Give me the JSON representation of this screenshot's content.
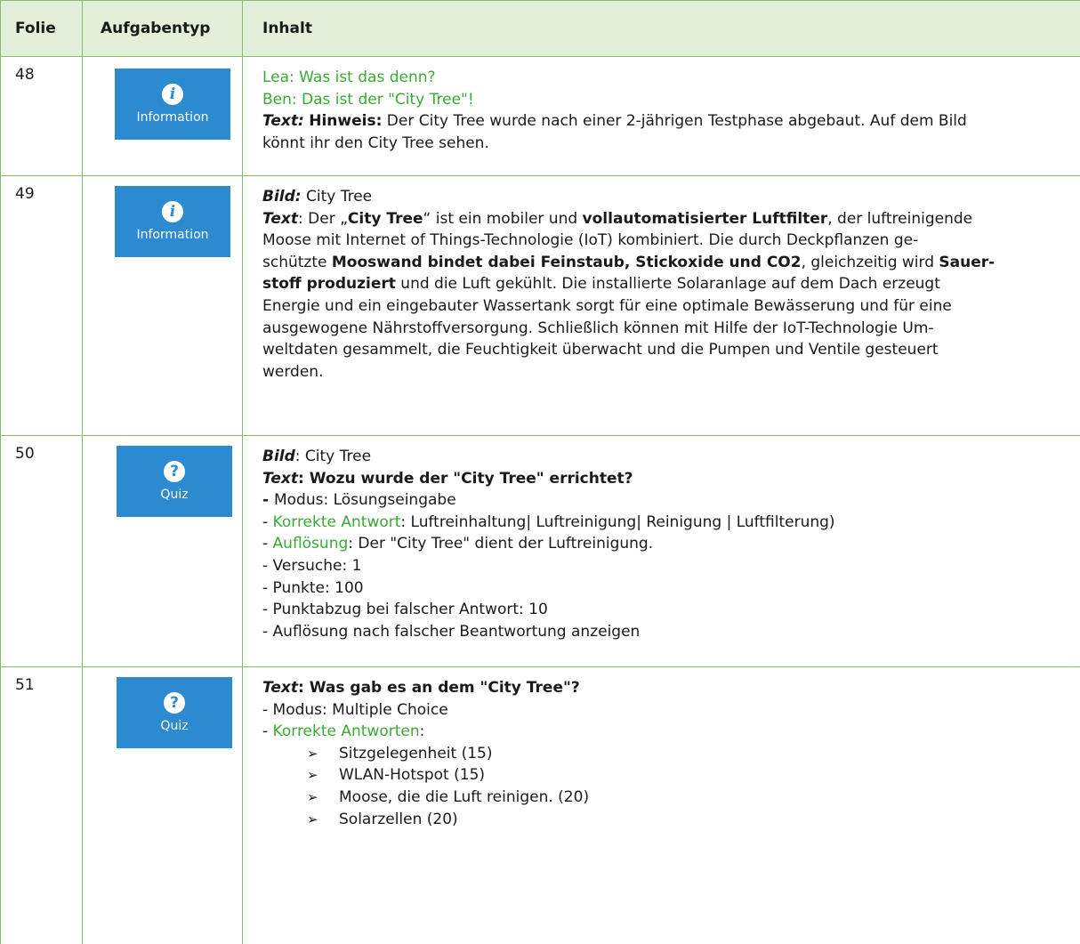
{
  "header": {
    "folie": "Folie",
    "aufgabentyp": "Aufgabentyp",
    "inhalt": "Inhalt"
  },
  "rows": [
    {
      "folie": "48",
      "tile": {
        "type": "Information",
        "icon": "info-icon",
        "glyph": "i",
        "color": "#2b8ad0"
      },
      "lines": {
        "l1": "Lea: Was ist das denn?",
        "l2": "Ben: Das ist der \"City Tree\"!",
        "t_label": "Text:",
        "t_hint": "Hinweis:",
        "t_rest1": "Der City Tree wurde nach einer 2-jährigen Testphase abgebaut. Auf dem Bild",
        "t_rest2": "könnt ihr den City Tree sehen."
      }
    },
    {
      "folie": "49",
      "tile": {
        "type": "Information",
        "icon": "info-icon",
        "glyph": "i",
        "color": "#2b8ad0"
      },
      "lines": {
        "bild_label": "Bild:",
        "bild_value": "City Tree",
        "text_label": "Text",
        "l1_a": ": Der „",
        "l1_b": "City Tree",
        "l1_c": "“ ist ein mobiler und ",
        "l1_d": "vollautomatisierter Luftfilter",
        "l1_e": ", der luftreinigende",
        "l2": "Moose mit Internet of Things-Technologie (IoT) kombiniert. Die durch Deckpflanzen ge-",
        "l3_a": "schützte ",
        "l3_b": "Mooswand bindet dabei Feinstaub, Stickoxide und CO2",
        "l3_c": ", gleichzeitig wird ",
        "l3_d": "Sauer-",
        "l4_a": "stoff produziert",
        "l4_b": " und die Luft gekühlt. Die installierte Solaranlage auf dem Dach erzeugt",
        "l5": "Energie und ein eingebauter Wassertank sorgt für eine optimale Bewässerung und für eine",
        "l6": "ausgewogene Nährstoffversorgung. Schließlich können mit Hilfe der IoT-Technologie Um-",
        "l7": "weltdaten gesammelt, die Feuchtigkeit überwacht und die Pumpen und Ventile gesteuert",
        "l8": "werden."
      }
    },
    {
      "folie": "50",
      "tile": {
        "type": "Quiz",
        "icon": "question-icon",
        "glyph": "?",
        "color": "#2b8ad0"
      },
      "lines": {
        "bild_label": "Bild",
        "bild_value": ": City Tree",
        "text_label": "Text",
        "text_colon": ": ",
        "question": "Wozu wurde der \"City Tree\" errichtet?",
        "modus_dash": "- ",
        "modus": "Modus: Lösungseingabe",
        "korrekt_dash": "- ",
        "korrekt_label": "Korrekte Antwort",
        "korrekt_value": ": Luftreinhaltung| Luftreinigung| Reinigung | Luftfilterung)",
        "aufl_dash": "- ",
        "aufl_label": "Auflösung",
        "aufl_value": ": Der \"City Tree\" dient der Luftreinigung.",
        "versuche": "- Versuche: 1",
        "punkte": "- Punkte: 100",
        "abzug": "- Punktabzug bei falscher Antwort: 10",
        "anzeigen": "- Auflösung nach falscher Beantwortung anzeigen"
      }
    },
    {
      "folie": "51",
      "tile": {
        "type": "Quiz",
        "icon": "question-icon",
        "glyph": "?",
        "color": "#2b8ad0"
      },
      "lines": {
        "text_label": "Text",
        "text_colon": ": ",
        "question": "Was gab es an dem \"City Tree\"?",
        "modus": "- Modus: Multiple Choice",
        "korrekt_dash": "- ",
        "korrekt_label": "Korrekte Antworten",
        "korrekt_colon": ":",
        "arrow": "➢",
        "answers": [
          "Sitzgelegenheit (15)",
          "WLAN-Hotspot (15)",
          "Moose, die die Luft reinigen. (20)",
          "Solarzellen (20)"
        ]
      }
    }
  ],
  "colors": {
    "header_bg": "#e2efd9",
    "border": "#8db86f",
    "green_text": "#3aaa35",
    "tile_bg": "#2b8ad0"
  }
}
